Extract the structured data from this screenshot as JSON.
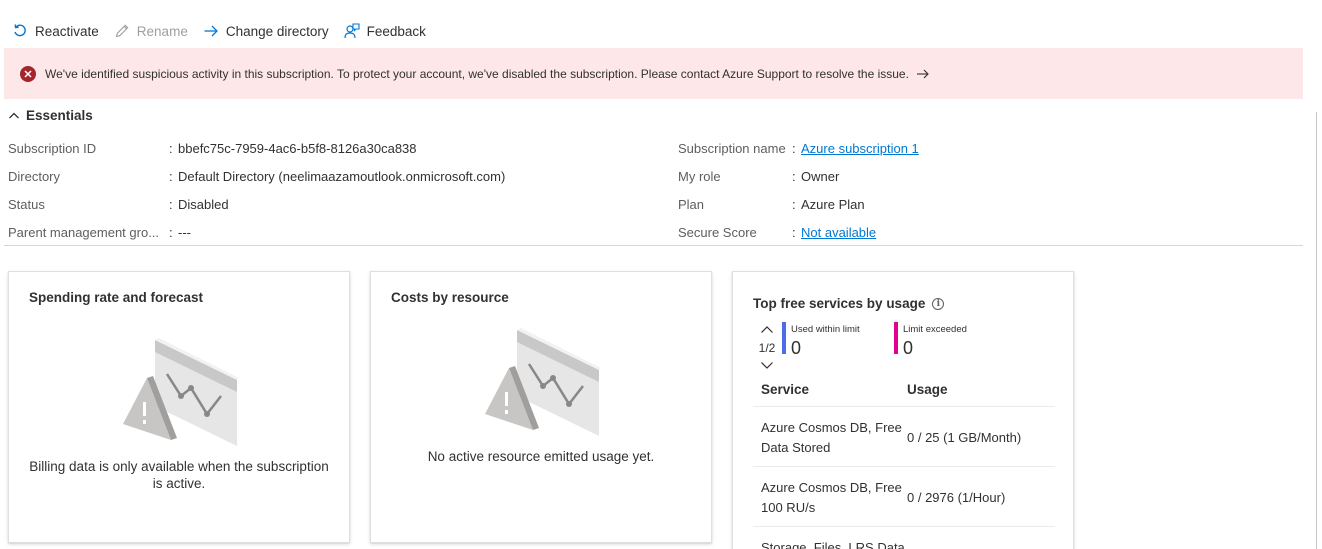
{
  "toolbar": {
    "reactivate": "Reactivate",
    "rename": "Rename",
    "change_directory": "Change directory",
    "feedback": "Feedback"
  },
  "alert": {
    "message": "We've identified suspicious activity in this subscription. To protect your account, we've disabled the subscription. Please contact Azure Support to resolve the issue."
  },
  "essentials": {
    "title": "Essentials",
    "left": [
      {
        "label": "Subscription ID",
        "value": "bbefc75c-7959-4ac6-b5f8-8126a30ca838"
      },
      {
        "label": "Directory",
        "value": "Default Directory (neelimaazamoutlook.onmicrosoft.com)"
      },
      {
        "label": "Status",
        "value": "Disabled"
      },
      {
        "label": "Parent management gro...",
        "value": "---"
      }
    ],
    "right": [
      {
        "label": "Subscription name",
        "value": "Azure subscription 1"
      },
      {
        "label": "My role",
        "value": "Owner"
      },
      {
        "label": "Plan",
        "value": "Azure Plan"
      },
      {
        "label": "Secure Score",
        "value": "Not available"
      }
    ]
  },
  "cards": {
    "spending": {
      "title": "Spending rate and forecast",
      "message": "Billing data is only available when the subscription is active."
    },
    "costs": {
      "title": "Costs by resource",
      "message": "No active resource emitted usage yet."
    },
    "free_services": {
      "title": "Top free services by usage",
      "pager": "1/2",
      "used_label": "Used within limit",
      "used_value": "0",
      "exceeded_label": "Limit exceeded",
      "exceeded_value": "0",
      "col_service": "Service",
      "col_usage": "Usage",
      "rows": [
        {
          "service": "Azure Cosmos DB, Free Data Stored",
          "usage": "0 / 25 (1 GB/Month)"
        },
        {
          "service": "Azure Cosmos DB, Free 100 RU/s",
          "usage": "0 / 2976 (1/Hour)"
        },
        {
          "service": "Storage, Files, LRS Data",
          "usage": ""
        }
      ]
    }
  },
  "colors": {
    "accent": "#0078d4",
    "alert_bg": "#fde7e9",
    "alert_icon": "#a4262c",
    "used_bar": "#4f6bed",
    "exceeded_bar": "#e3008c"
  }
}
